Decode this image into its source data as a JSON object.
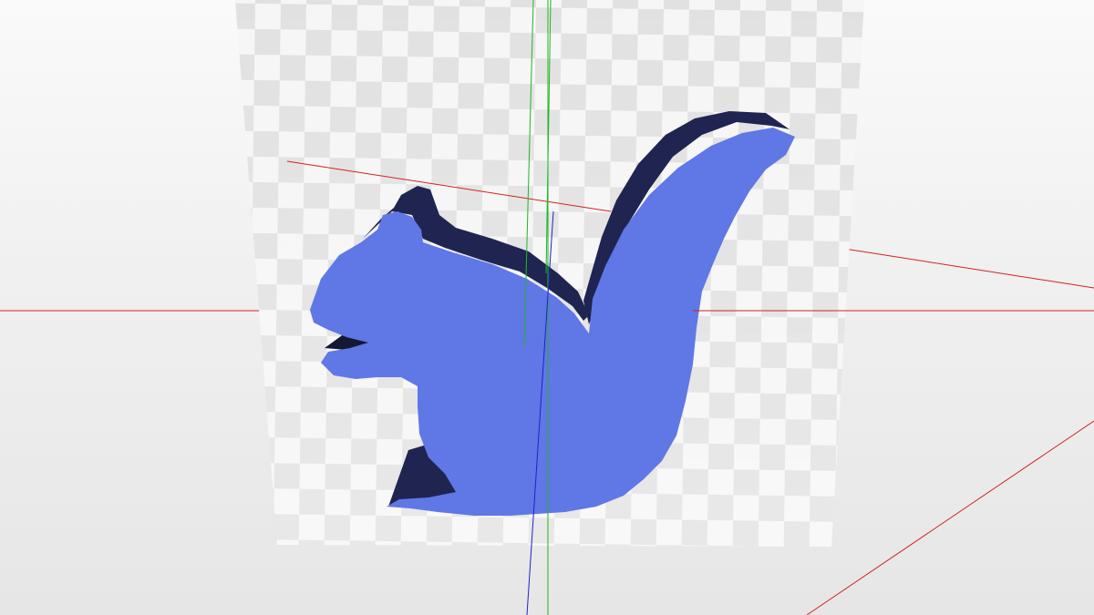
{
  "viewport": {
    "kind": "3d-model-viewer",
    "background_top": "#fafafa",
    "background_bottom": "#e6e6e6"
  },
  "model": {
    "shape": "squirrel-silhouette",
    "face_color": "#6077e6",
    "extrusion_color": "#1f2550",
    "extrusion_dark_color": "#141833"
  },
  "texture_plane": {
    "pattern": "checkerboard",
    "light_color": "#f4f4f4",
    "dark_color": "#dcdcdc"
  },
  "axes": {
    "x_color": "#d42020",
    "y_color": "#21b521",
    "z_color": "#2020d0"
  }
}
